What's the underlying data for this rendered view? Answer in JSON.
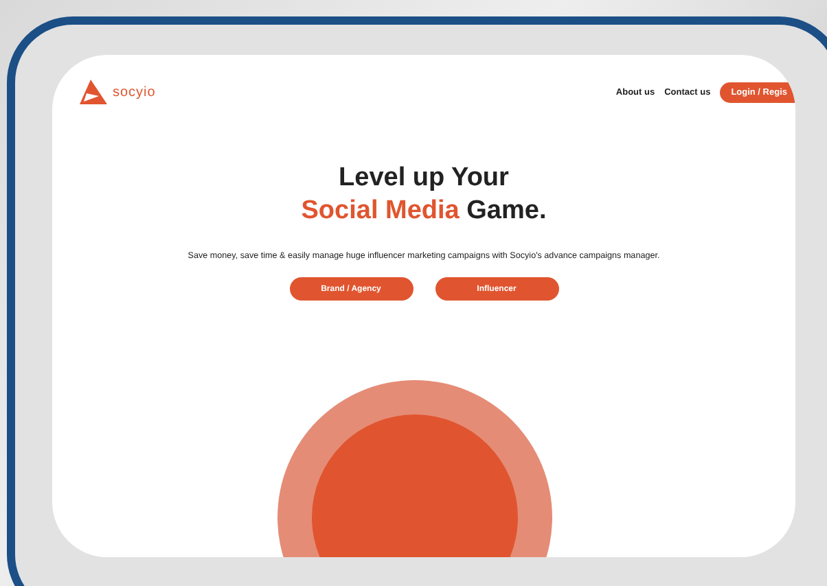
{
  "brand": {
    "name": "socyio"
  },
  "nav": {
    "links": [
      "About us",
      "Contact us"
    ],
    "cta": "Login / Regis"
  },
  "hero": {
    "title_line": "Level up Your",
    "title_highlight": "Social Media",
    "title_rest": "Game.",
    "text": "Save money, save time & easily manage huge influencer marketing campaigns with Socyio's advance campaigns manager.",
    "buttons": [
      "Brand / Agency",
      "Influencer"
    ]
  }
}
